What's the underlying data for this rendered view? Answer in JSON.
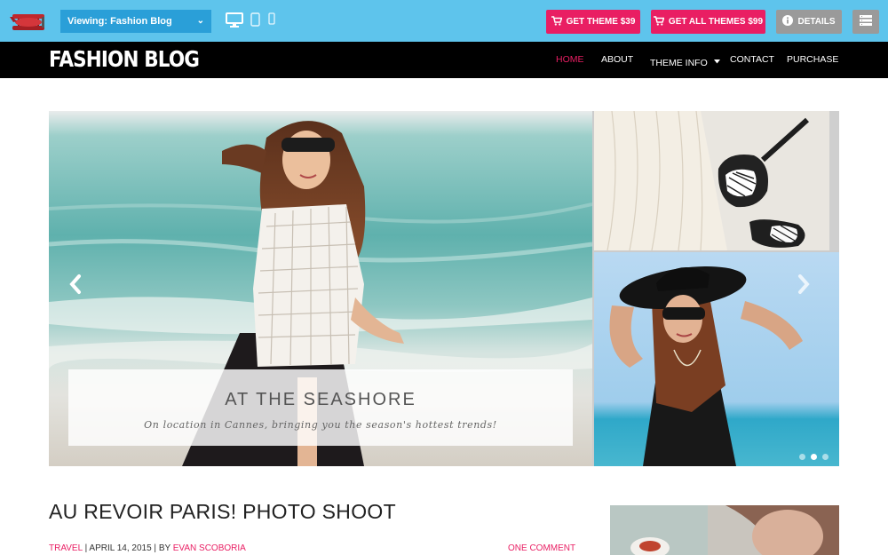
{
  "demobar": {
    "viewing_label": "Viewing: Fashion Blog",
    "devices": [
      "desktop-icon",
      "tablet-icon",
      "mobile-icon"
    ],
    "get_theme_label": "GET THEME $39",
    "get_all_themes_label": "GET ALL THEMES $99",
    "details_label": "DETAILS",
    "accent": "#e91e63",
    "bar_color": "#5ec4ec"
  },
  "site": {
    "title": "FASHION BLOG",
    "nav": [
      "HOME",
      "ABOUT",
      "THEME INFO",
      "CONTACT",
      "PURCHASE"
    ],
    "active_nav": "HOME"
  },
  "slider": {
    "caption_title": "AT THE SEASHORE",
    "caption_subtitle": "On location in Cannes, bringing you the season's hottest trends!",
    "dots_total": 3,
    "active_dot": 2
  },
  "post": {
    "title": "AU REVOIR PARIS! PHOTO SHOOT",
    "category": "TRAVEL",
    "date": "APRIL 14, 2015",
    "by": "BY",
    "author": "EVAN SCOBORIA",
    "comments": "ONE COMMENT"
  }
}
